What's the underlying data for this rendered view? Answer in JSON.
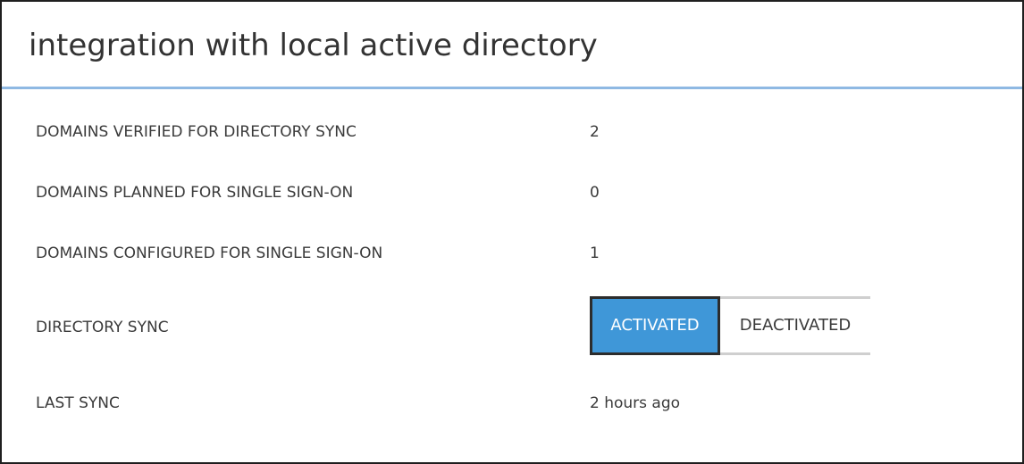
{
  "header": {
    "title": "integration with local active directory"
  },
  "rows": [
    {
      "label": "DOMAINS VERIFIED FOR DIRECTORY SYNC",
      "value": "2"
    },
    {
      "label": "DOMAINS PLANNED FOR SINGLE SIGN-ON",
      "value": "0"
    },
    {
      "label": "DOMAINS CONFIGURED FOR SINGLE SIGN-ON",
      "value": "1"
    },
    {
      "label": "DIRECTORY SYNC"
    },
    {
      "label": "LAST SYNC",
      "value": "2 hours ago"
    }
  ],
  "directory_sync_toggle": {
    "options": [
      "ACTIVATED",
      "DEACTIVATED"
    ],
    "selected": "ACTIVATED"
  },
  "colors": {
    "header_rule": "#8fb9e3",
    "active_option_bg": "#3f97d8",
    "active_option_border": "#2c2c2c",
    "toggle_border": "#cfcfcf"
  }
}
